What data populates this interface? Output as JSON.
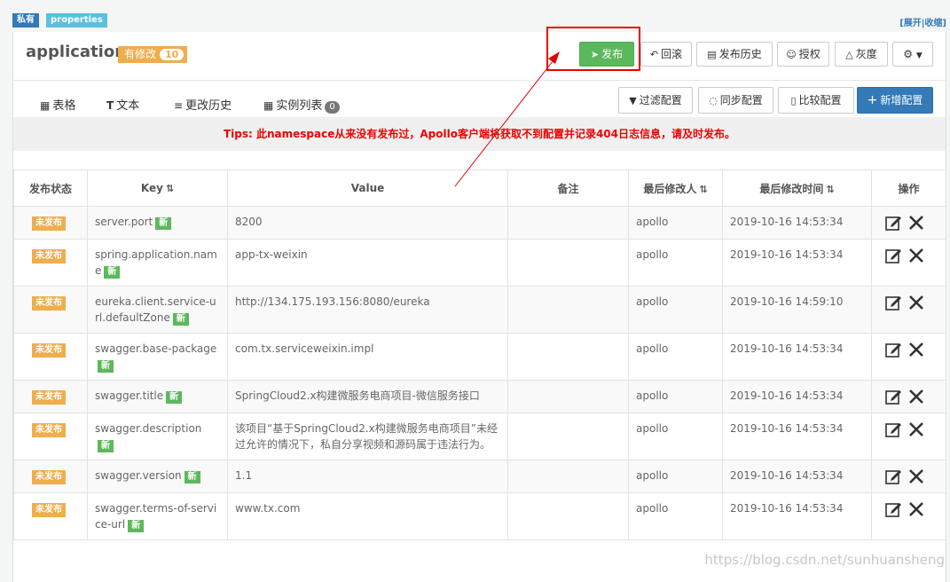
{
  "tags": {
    "private": "私有",
    "properties": "properties"
  },
  "expand_link": "[展开|收缩]",
  "namespace": {
    "name": "application",
    "modified_label": "有修改",
    "modified_count": "10"
  },
  "toolbar": {
    "publish": "发布",
    "rollback": "回滚",
    "history": "发布历史",
    "grant": "授权",
    "gray": "灰度"
  },
  "tabs": {
    "table": "表格",
    "text": "文本",
    "history": "更改历史",
    "instances": "实例列表",
    "instances_count": "0"
  },
  "actions": {
    "filter": "过滤配置",
    "sync": "同步配置",
    "compare": "比较配置",
    "add": "新增配置"
  },
  "tips": "Tips: 此namespace从来没有发布过，Apollo客户端将获取不到配置并记录404日志信息，请及时发布。",
  "table": {
    "headers": [
      "发布状态",
      "Key",
      "Value",
      "备注",
      "最后修改人",
      "最后修改时间",
      "操作"
    ],
    "status_label": "未发布",
    "new_label": "新",
    "rows": [
      {
        "key": "server.port",
        "value": "8200",
        "comment": "",
        "modifier": "apollo",
        "time": "2019-10-16 14:53:34"
      },
      {
        "key": "spring.application.name",
        "value": "app-tx-weixin",
        "comment": "",
        "modifier": "apollo",
        "time": "2019-10-16 14:53:34"
      },
      {
        "key": "eureka.client.service-url.defaultZone",
        "value": "http://134.175.193.156:8080/eureka",
        "comment": "",
        "modifier": "apollo",
        "time": "2019-10-16 14:59:10"
      },
      {
        "key": "swagger.base-package",
        "value": "com.tx.serviceweixin.impl",
        "comment": "",
        "modifier": "apollo",
        "time": "2019-10-16 14:53:34"
      },
      {
        "key": "swagger.title",
        "value": "SpringCloud2.x构建微服务电商项目-微信服务接口",
        "comment": "",
        "modifier": "apollo",
        "time": "2019-10-16 14:53:34"
      },
      {
        "key": "swagger.description",
        "value": "该项目“基于SpringCloud2.x构建微服务电商项目”未经过允许的情况下，私自分享视频和源码属于违法行为。",
        "comment": "",
        "modifier": "apollo",
        "time": "2019-10-16 14:53:34"
      },
      {
        "key": "swagger.version",
        "value": "1.1",
        "comment": "",
        "modifier": "apollo",
        "time": "2019-10-16 14:53:34"
      },
      {
        "key": "swagger.terms-of-service-url",
        "value": "www.tx.com",
        "comment": "",
        "modifier": "apollo",
        "time": "2019-10-16 14:53:34"
      }
    ]
  },
  "watermark": "https://blog.csdn.net/sunhuansheng",
  "colors": {
    "publish": "#5cb85c",
    "modified": "#f0ad4e",
    "add": "#337ab7",
    "tips": "#e00000",
    "highlight": "#e00000"
  }
}
